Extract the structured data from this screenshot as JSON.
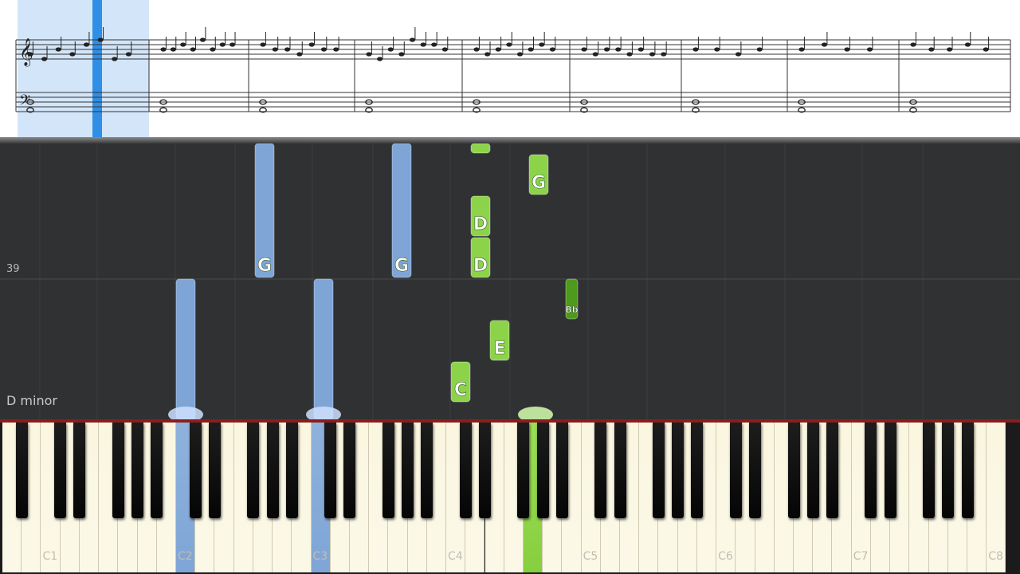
{
  "sheet": {
    "measures": 9
  },
  "roll": {
    "measure_number": "39",
    "key_signature_label": "D minor",
    "colors": {
      "left_hand": "#7ea5d6",
      "right_hand": "#8cd34a",
      "right_hand_dark": "#4e9a1c"
    },
    "notes": [
      {
        "name": "G",
        "hand": "left"
      },
      {
        "name": "G",
        "hand": "left"
      },
      {
        "name": "",
        "hand": "left"
      },
      {
        "name": "",
        "hand": "left"
      },
      {
        "name": "",
        "hand": "right"
      },
      {
        "name": "G",
        "hand": "right"
      },
      {
        "name": "D",
        "hand": "right"
      },
      {
        "name": "D",
        "hand": "right"
      },
      {
        "name": "Bb",
        "hand": "right"
      },
      {
        "name": "E",
        "hand": "right"
      },
      {
        "name": "C",
        "hand": "right"
      }
    ]
  },
  "keyboard": {
    "octave_labels": [
      "C1",
      "C2",
      "C3",
      "C4",
      "C5",
      "C6",
      "C7",
      "C8"
    ]
  }
}
